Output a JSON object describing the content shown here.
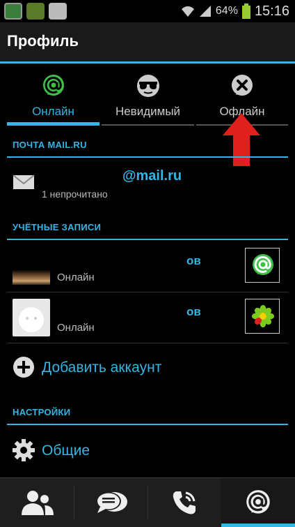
{
  "status_bar": {
    "battery": "64%",
    "time": "15:16"
  },
  "header": {
    "title": "Профиль"
  },
  "tabs": [
    {
      "label": "Онлайн",
      "icon": "mail-agent-online-icon",
      "active": true
    },
    {
      "label": "Невидимый",
      "icon": "invisible-sunglasses-icon",
      "active": false
    },
    {
      "label": "Офлайн",
      "icon": "offline-x-icon",
      "active": false
    }
  ],
  "mail_section": {
    "header": "ПОЧТА MAIL.RU",
    "email_domain": "@mail.ru",
    "unread": "1 непрочитано"
  },
  "accounts_section": {
    "header": "УЧЁТНЫЕ ЗАПИСИ",
    "accounts": [
      {
        "name_suffix": "ов",
        "status": "Онлайн",
        "service": "mail-agent-icon"
      },
      {
        "name_suffix": "ов",
        "status": "Онлайн",
        "service": "icq-flower-icon"
      }
    ],
    "add_account": "Добавить аккаунт"
  },
  "settings_section": {
    "header": "НАСТРОЙКИ",
    "general": "Общие"
  },
  "bottom_nav": [
    {
      "icon": "contacts-icon",
      "active": false
    },
    {
      "icon": "chats-icon",
      "active": false
    },
    {
      "icon": "calls-icon",
      "active": false
    },
    {
      "icon": "profile-at-icon",
      "active": true
    }
  ],
  "colors": {
    "accent": "#33b5e5",
    "arrow": "#e0201c",
    "online_green": "#3fbf4a"
  }
}
